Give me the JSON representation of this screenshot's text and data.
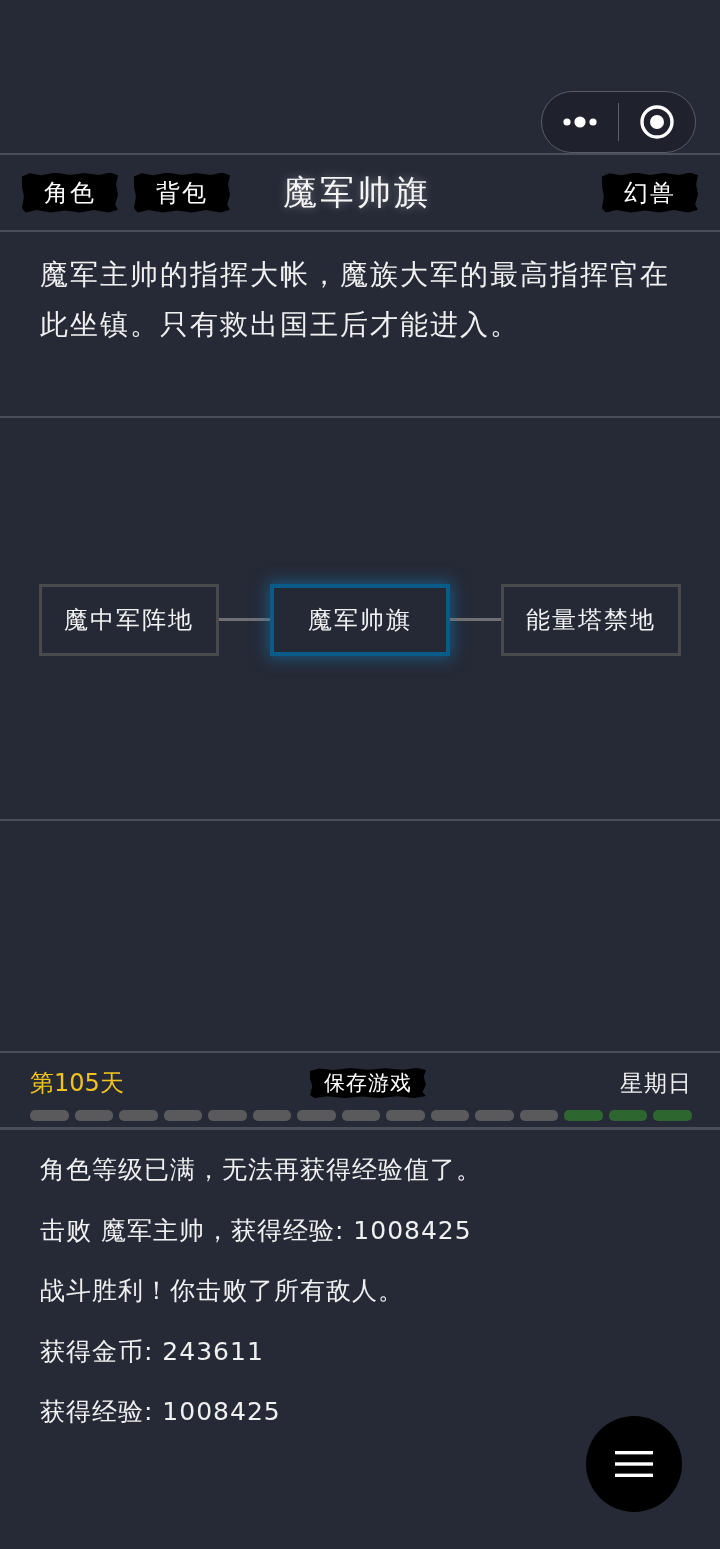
{
  "header": {
    "left_buttons": [
      {
        "label": "角色"
      },
      {
        "label": "背包"
      }
    ],
    "title": "魔军帅旗",
    "right_buttons": [
      {
        "label": "幻兽"
      }
    ]
  },
  "description": "魔军主帅的指挥大帐，魔族大军的最高指挥官在此坐镇。只有救出国王后才能进入。",
  "map": {
    "nodes": [
      {
        "label": "魔中军阵地",
        "selected": false
      },
      {
        "label": "魔军帅旗",
        "selected": true
      },
      {
        "label": "能量塔禁地",
        "selected": false
      }
    ]
  },
  "status_bar": {
    "day": "第105天",
    "save_button": "保存游戏",
    "weekday": "星期日",
    "segments": [
      {
        "on": false
      },
      {
        "on": false
      },
      {
        "on": false
      },
      {
        "on": false
      },
      {
        "on": false
      },
      {
        "on": false
      },
      {
        "on": false
      },
      {
        "on": false
      },
      {
        "on": false
      },
      {
        "on": false
      },
      {
        "on": false
      },
      {
        "on": false
      },
      {
        "on": true
      },
      {
        "on": true
      },
      {
        "on": true
      }
    ]
  },
  "log": [
    "角色等级已满，无法再获得经验值了。",
    "击败 魔军主帅，获得经验: 1008425",
    "战斗胜利！你击败了所有敌人。",
    "获得金币: 243611",
    "获得经验: 1008425"
  ]
}
